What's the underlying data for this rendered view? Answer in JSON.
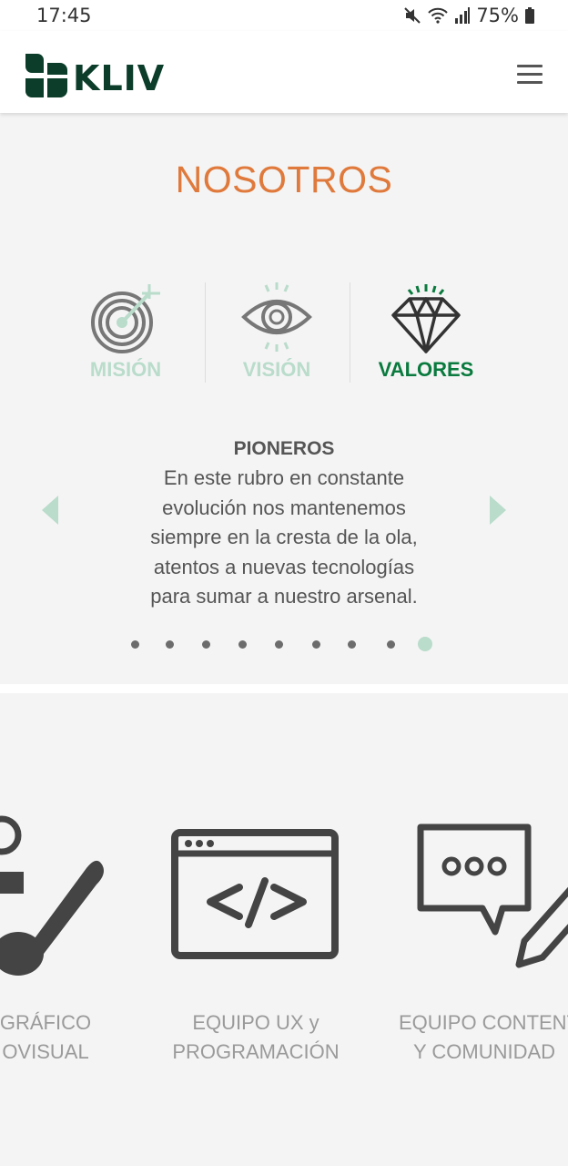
{
  "status_bar": {
    "time": "17:45",
    "battery": "75%",
    "icons": [
      "mute-icon",
      "wifi-icon",
      "signal-icon",
      "battery-icon"
    ]
  },
  "header": {
    "logo_text": "KLIV",
    "menu_icon": "hamburger-menu-icon"
  },
  "colors": {
    "brand_dark_green": "#0b3d2a",
    "accent_orange": "#e07a3c",
    "mint": "#b9dccb",
    "active_green": "#0a7a3e",
    "icon_gray": "#555555"
  },
  "nosotros": {
    "title": "NOSOTROS",
    "tabs": [
      {
        "label": "MISIÓN",
        "icon": "target-icon",
        "active": false
      },
      {
        "label": "VISIÓN",
        "icon": "eye-icon",
        "active": false
      },
      {
        "label": "VALORES",
        "icon": "diamond-icon",
        "active": true
      }
    ],
    "slide": {
      "heading": "PIONEROS",
      "lines": [
        "En este rubro en constante",
        "evolución nos mantenemos",
        "siempre en la cresta de la ola,",
        "atentos a nuevas tecnologías",
        "para sumar a nuestro arsenal."
      ]
    },
    "carousel": {
      "total_slides": 9,
      "active_index": 9
    }
  },
  "teams": [
    {
      "line1": "GRÁFICO",
      "line2": "OVISUAL",
      "icon": "design-brush-icon"
    },
    {
      "line1": "EQUIPO UX y",
      "line2": "PROGRAMACIÓN",
      "icon": "code-window-icon"
    },
    {
      "line1": "EQUIPO CONTENT",
      "line2": "Y COMUNIDAD",
      "icon": "chat-pencil-icon"
    }
  ]
}
